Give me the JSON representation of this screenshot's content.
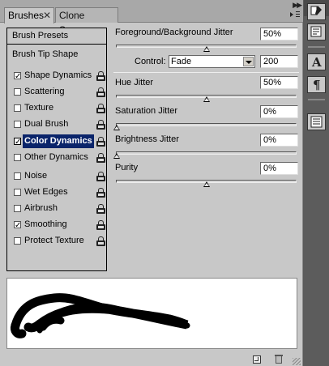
{
  "tabs": [
    {
      "label": "Brushes",
      "active": true
    },
    {
      "label": "Clone Source",
      "active": false
    }
  ],
  "left_panel": {
    "presets_label": "Brush Presets",
    "tip_shape_label": "Brush Tip Shape",
    "options": [
      {
        "label": "Shape Dynamics",
        "checked": true,
        "lock": true
      },
      {
        "label": "Scattering",
        "checked": false,
        "lock": true
      },
      {
        "label": "Texture",
        "checked": false,
        "lock": true
      },
      {
        "label": "Dual Brush",
        "checked": false,
        "lock": true
      },
      {
        "label": "Color Dynamics",
        "checked": true,
        "lock": true,
        "selected": true
      },
      {
        "label": "Other Dynamics",
        "checked": false,
        "lock": true
      },
      {
        "label": "Noise",
        "checked": false,
        "lock": true
      },
      {
        "label": "Wet Edges",
        "checked": false,
        "lock": true
      },
      {
        "label": "Airbrush",
        "checked": false,
        "lock": true
      },
      {
        "label": "Smoothing",
        "checked": true,
        "lock": true
      },
      {
        "label": "Protect Texture",
        "checked": false,
        "lock": true
      }
    ]
  },
  "settings": {
    "fg_bg_jitter": {
      "label": "Foreground/Background Jitter",
      "value": "50%",
      "fraction": 0.5
    },
    "control": {
      "label": "Control:",
      "selected": "Fade",
      "value": "200"
    },
    "hue_jitter": {
      "label": "Hue Jitter",
      "value": "50%",
      "fraction": 0.5
    },
    "saturation_jitter": {
      "label": "Saturation Jitter",
      "value": "0%",
      "fraction": 0
    },
    "brightness_jitter": {
      "label": "Brightness Jitter",
      "value": "0%",
      "fraction": 0
    },
    "purity": {
      "label": "Purity",
      "value": "0%",
      "fraction": 0.5
    }
  },
  "dock": {
    "icons": [
      "brush-preset-icon",
      "clone-source-icon",
      "character-icon",
      "paragraph-icon",
      "notes-icon"
    ]
  }
}
